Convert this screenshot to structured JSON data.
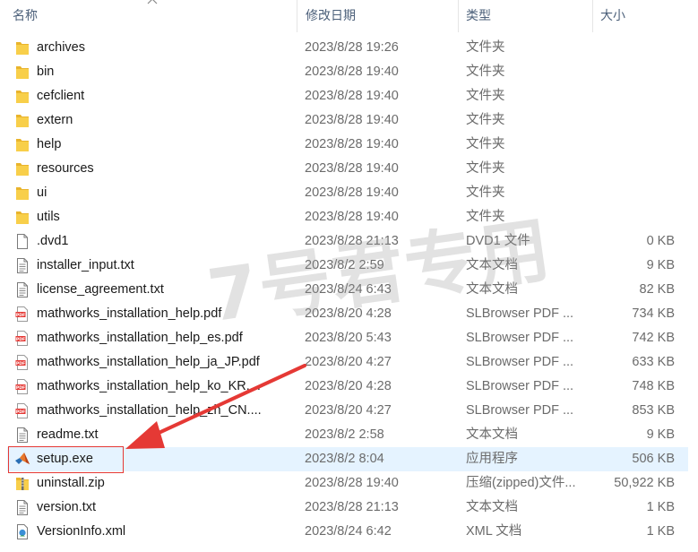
{
  "columns": {
    "name": "名称",
    "modified": "修改日期",
    "type": "类型",
    "size": "大小"
  },
  "files": [
    {
      "icon": "folder-icon",
      "name": "archives",
      "modified": "2023/8/28 19:26",
      "type": "文件夹",
      "size": ""
    },
    {
      "icon": "folder-icon",
      "name": "bin",
      "modified": "2023/8/28 19:40",
      "type": "文件夹",
      "size": ""
    },
    {
      "icon": "folder-icon",
      "name": "cefclient",
      "modified": "2023/8/28 19:40",
      "type": "文件夹",
      "size": ""
    },
    {
      "icon": "folder-icon",
      "name": "extern",
      "modified": "2023/8/28 19:40",
      "type": "文件夹",
      "size": ""
    },
    {
      "icon": "folder-icon",
      "name": "help",
      "modified": "2023/8/28 19:40",
      "type": "文件夹",
      "size": ""
    },
    {
      "icon": "folder-icon",
      "name": "resources",
      "modified": "2023/8/28 19:40",
      "type": "文件夹",
      "size": ""
    },
    {
      "icon": "folder-icon",
      "name": "ui",
      "modified": "2023/8/28 19:40",
      "type": "文件夹",
      "size": ""
    },
    {
      "icon": "folder-icon",
      "name": "utils",
      "modified": "2023/8/28 19:40",
      "type": "文件夹",
      "size": ""
    },
    {
      "icon": "blank-file-icon",
      "name": ".dvd1",
      "modified": "2023/8/28 21:13",
      "type": "DVD1 文件",
      "size": "0 KB"
    },
    {
      "icon": "text-file-icon",
      "name": "installer_input.txt",
      "modified": "2023/8/2 2:59",
      "type": "文本文档",
      "size": "9 KB"
    },
    {
      "icon": "text-file-icon",
      "name": "license_agreement.txt",
      "modified": "2023/8/24 6:43",
      "type": "文本文档",
      "size": "82 KB"
    },
    {
      "icon": "pdf-file-icon",
      "name": "mathworks_installation_help.pdf",
      "modified": "2023/8/20 4:28",
      "type": "SLBrowser PDF ...",
      "size": "734 KB"
    },
    {
      "icon": "pdf-file-icon",
      "name": "mathworks_installation_help_es.pdf",
      "modified": "2023/8/20 5:43",
      "type": "SLBrowser PDF ...",
      "size": "742 KB"
    },
    {
      "icon": "pdf-file-icon",
      "name": "mathworks_installation_help_ja_JP.pdf",
      "modified": "2023/8/20 4:27",
      "type": "SLBrowser PDF ...",
      "size": "633 KB"
    },
    {
      "icon": "pdf-file-icon",
      "name": "mathworks_installation_help_ko_KR....",
      "modified": "2023/8/20 4:28",
      "type": "SLBrowser PDF ...",
      "size": "748 KB"
    },
    {
      "icon": "pdf-file-icon",
      "name": "mathworks_installation_help_zh_CN....",
      "modified": "2023/8/20 4:27",
      "type": "SLBrowser PDF ...",
      "size": "853 KB"
    },
    {
      "icon": "text-file-icon",
      "name": "readme.txt",
      "modified": "2023/8/2 2:58",
      "type": "文本文档",
      "size": "9 KB"
    },
    {
      "icon": "matlab-setup-icon",
      "name": "setup.exe",
      "modified": "2023/8/2 8:04",
      "type": "应用程序",
      "size": "506 KB",
      "selected": true
    },
    {
      "icon": "zip-file-icon",
      "name": "uninstall.zip",
      "modified": "2023/8/28 19:40",
      "type": "压缩(zipped)文件...",
      "size": "50,922 KB"
    },
    {
      "icon": "text-file-icon",
      "name": "version.txt",
      "modified": "2023/8/28 21:13",
      "type": "文本文档",
      "size": "1 KB"
    },
    {
      "icon": "xml-file-icon",
      "name": "VersionInfo.xml",
      "modified": "2023/8/24 6:42",
      "type": "XML 文档",
      "size": "1 KB"
    }
  ],
  "watermark": "7号君专用",
  "colors": {
    "selection": "#e5f3ff",
    "annotation": "#e53935",
    "folder": "#f3c33c"
  }
}
